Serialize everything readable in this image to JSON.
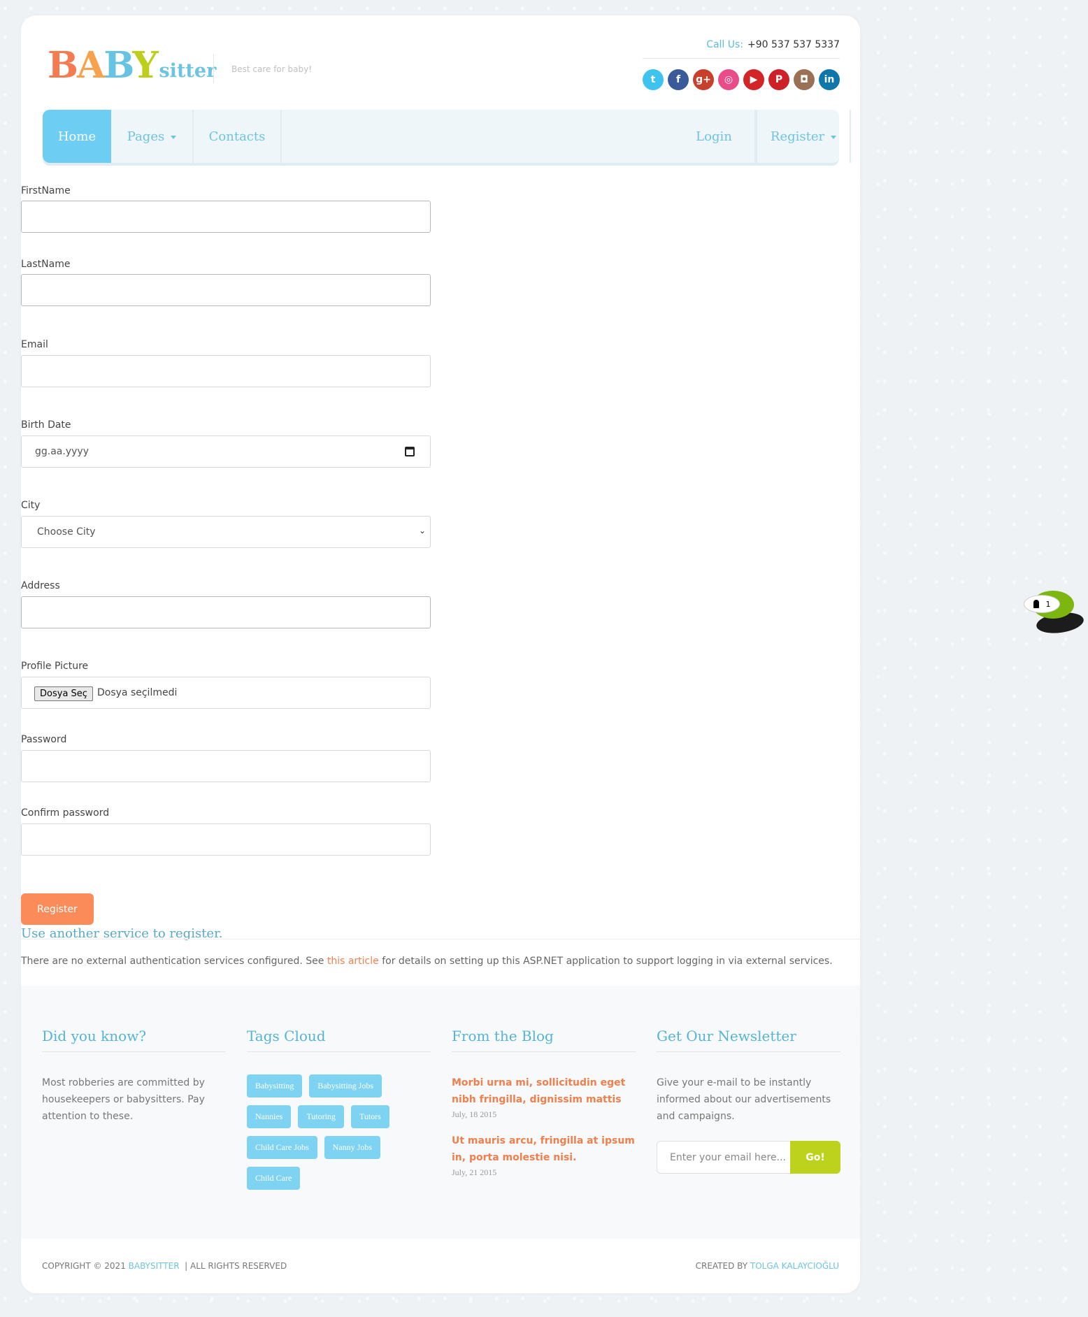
{
  "brand": {
    "logo_b1": "B",
    "logo_a": "A",
    "logo_b2": "B",
    "logo_y": "Y",
    "logo_sitter": "sitter",
    "tagline": "Best care for baby!"
  },
  "contact": {
    "label": "Call Us:",
    "phone": "+90 537 537 5337"
  },
  "social": [
    {
      "name": "twitter-icon",
      "glyph": "t",
      "color": "#3ec2ef"
    },
    {
      "name": "facebook-icon",
      "glyph": "f",
      "color": "#3b5a9a"
    },
    {
      "name": "google-plus-icon",
      "glyph": "g+",
      "color": "#c7402b"
    },
    {
      "name": "dribbble-icon",
      "glyph": "◎",
      "color": "#ea4c89"
    },
    {
      "name": "youtube-icon",
      "glyph": "▶",
      "color": "#d12528"
    },
    {
      "name": "pinterest-icon",
      "glyph": "P",
      "color": "#cd2027"
    },
    {
      "name": "instagram-icon",
      "glyph": "◘",
      "color": "#9b7156"
    },
    {
      "name": "linkedin-icon",
      "glyph": "in",
      "color": "#0e76a8"
    }
  ],
  "nav": {
    "home": "Home",
    "pages": "Pages",
    "contacts": "Contacts",
    "login": "Login",
    "register": "Register"
  },
  "form": {
    "firstname_label": "FirstName",
    "lastname_label": "LastName",
    "email_label": "Email",
    "birthdate_label": "Birth Date",
    "birthdate_placeholder": "gg.aa.yyyy",
    "city_label": "City",
    "city_selected": "Choose City",
    "address_label": "Address",
    "picture_label": "Profile Picture",
    "file_button": "Dosya Seç",
    "file_status": "Dosya seçilmedi",
    "password_label": "Password",
    "confirm_label": "Confirm password",
    "submit": "Register"
  },
  "external": {
    "heading": "Use another service to register.",
    "note_before": "There are no external authentication services configured. See ",
    "note_link": "this article",
    "note_after": " for details on setting up this ASP.NET application to support logging in via external services."
  },
  "footer": {
    "didyouknow_title": "Did you know?",
    "didyouknow_text": "Most robberies are committed by housekeepers or babysitters. Pay attention to these.",
    "tags_title": "Tags Cloud",
    "tags": [
      "Babysitting",
      "Babysitting Jobs",
      "Nannies",
      "Tutoring",
      "Tutors",
      "Child Care Jobs",
      "Nanny Jobs",
      "Child Care"
    ],
    "blog_title": "From the Blog",
    "blog": [
      {
        "title": "Morbi urna mi, sollicitudin eget nibh fringilla, dignissim mattis",
        "date": "July, 18 2015"
      },
      {
        "title": "Ut mauris arcu, fringilla at ipsum in, porta molestie nisi.",
        "date": "July, 21 2015"
      }
    ],
    "newsletter_title": "Get Our Newsletter",
    "newsletter_text": "Give your e-mail to be instantly informed about our advertisements and campaigns.",
    "newsletter_placeholder": "Enter your email here...",
    "newsletter_button": "Go!"
  },
  "bottom": {
    "copyright_prefix": "COPYRIGHT © 2021",
    "copyright_brand": "BABYSITTER",
    "copyright_suffix": "|  ALL RIGHTS RESERVED",
    "created_prefix": "CREATED BY",
    "created_author": "TOLGA KALAYCIOĞLU"
  },
  "chat_widget": {
    "count": "1"
  }
}
